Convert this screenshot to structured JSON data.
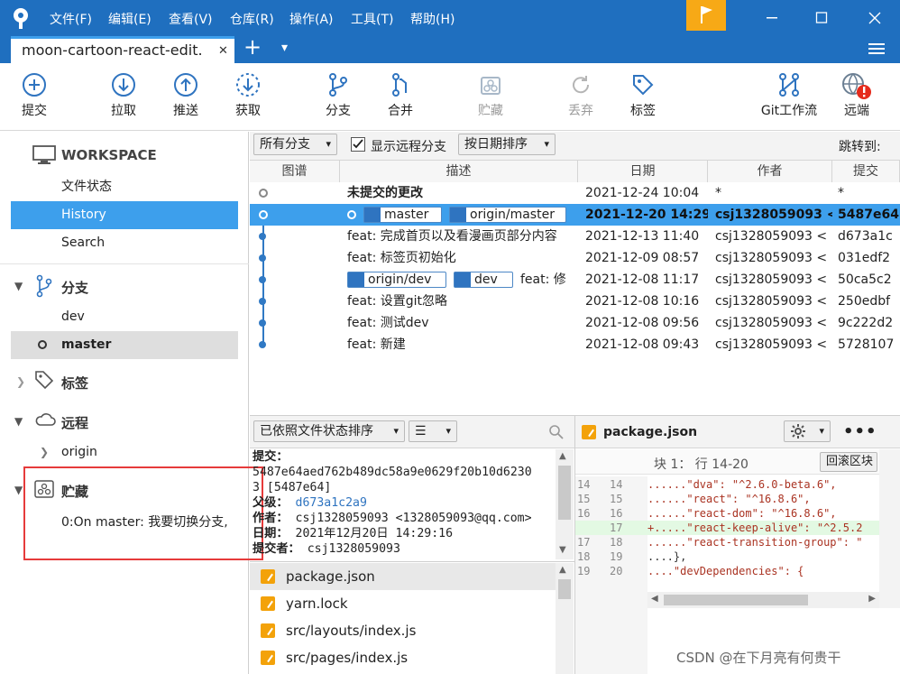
{
  "menu": {
    "items": [
      "文件(F)",
      "编辑(E)",
      "查看(V)",
      "仓库(R)",
      "操作(A)",
      "工具(T)",
      "帮助(H)"
    ]
  },
  "tab": {
    "title": "moon-cartoon-react-edit.",
    "close": "✕",
    "add": "+",
    "dropdown": "▾"
  },
  "toolbar": {
    "commit": "提交",
    "pull": "拉取",
    "push": "推送",
    "fetch": "获取",
    "branch": "分支",
    "merge": "合并",
    "stash": "贮藏",
    "discard": "丢弃",
    "tag": "标签",
    "gitflow": "Git工作流",
    "remote": "远端"
  },
  "sidebar": {
    "workspace": "WORKSPACE",
    "file_status": "文件状态",
    "history": "History",
    "search": "Search",
    "branches_head": "分支",
    "branch_dev": "dev",
    "branch_master": "master",
    "tags_head": "标签",
    "remotes_head": "远程",
    "remote_origin": "origin",
    "stash_head": "贮藏",
    "stash_item": "0:On master: 我要切换分支,"
  },
  "filter": {
    "branches": "所有分支",
    "show_remote": "显示远程分支",
    "sort": "按日期排序",
    "jump": "跳转到:"
  },
  "columns": {
    "graph": "图谱",
    "desc": "描述",
    "date": "日期",
    "author": "作者",
    "commit": "提交"
  },
  "commits": [
    {
      "desc": "未提交的更改",
      "date": "2021-12-24 10:04",
      "author": "*",
      "hash": "*",
      "refs": []
    },
    {
      "desc": "",
      "date": "2021-12-20 14:29",
      "author": "csj1328059093 <",
      "hash": "5487e64",
      "refs": [
        "master",
        "origin/master"
      ]
    },
    {
      "desc": "feat: 完成首页以及看漫画页部分内容",
      "date": "2021-12-13 11:40",
      "author": "csj1328059093 <",
      "hash": "d673a1c",
      "refs": []
    },
    {
      "desc": "feat: 标签页初始化",
      "date": "2021-12-09 08:57",
      "author": "csj1328059093 <",
      "hash": "031edf2",
      "refs": []
    },
    {
      "desc": "feat: 修",
      "date": "2021-12-08 11:17",
      "author": "csj1328059093 <",
      "hash": "50ca5c2",
      "refs": [
        "origin/dev",
        "dev"
      ]
    },
    {
      "desc": "feat: 设置git忽略",
      "date": "2021-12-08 10:16",
      "author": "csj1328059093 <",
      "hash": "250edbf",
      "refs": []
    },
    {
      "desc": "feat: 测试dev",
      "date": "2021-12-08 09:56",
      "author": "csj1328059093 <",
      "hash": "9c222d2",
      "refs": []
    },
    {
      "desc": "feat: 新建",
      "date": "2021-12-08 09:43",
      "author": "csj1328059093 <",
      "hash": "5728107",
      "refs": []
    }
  ],
  "files_panel": {
    "sort": "已依照文件状态排序",
    "view": "☰"
  },
  "details": {
    "commit_label": "提交：",
    "commit_hash_1": "5487e64aed762b489dc58a9e0629f20b10d6230",
    "commit_hash_2": "3 [5487e64]",
    "parent_label": "父级：",
    "parent": "d673a1c2a9",
    "author_label": "作者：",
    "author": "csj1328059093 <1328059093@qq.com>",
    "date_label": "日期：",
    "date": "2021年12月20日 14:29:16",
    "committer_label": "提交者：",
    "committer": "csj1328059093"
  },
  "files": [
    "package.json",
    "yarn.lock",
    "src/layouts/index.js",
    "src/pages/index.js"
  ],
  "diff": {
    "file": "package.json",
    "hunk": "块 1： 行 14-20",
    "revert": "回滚区块",
    "lines": [
      {
        "a": "14",
        "b": "14",
        "text": "......\"dva\": \"^2.6.0-beta.6\",",
        "add": false
      },
      {
        "a": "15",
        "b": "15",
        "text": "......\"react\": \"^16.8.6\",",
        "add": false
      },
      {
        "a": "16",
        "b": "16",
        "text": "......\"react-dom\": \"^16.8.6\",",
        "add": false
      },
      {
        "a": "",
        "b": "17",
        "text": "+.....\"react-keep-alive\": \"^2.5.2",
        "add": true
      },
      {
        "a": "17",
        "b": "18",
        "text": "......\"react-transition-group\": \"",
        "add": false
      },
      {
        "a": "18",
        "b": "19",
        "text": "....},",
        "add": false
      },
      {
        "a": "19",
        "b": "20",
        "text": "....\"devDependencies\": {",
        "add": false
      }
    ]
  },
  "watermark": "CSDN @在下月亮有何贵干",
  "colors": {
    "brand": "#1f6fbf",
    "selection": "#3d9fec",
    "flag": "#f7a916",
    "highlight": "#e63b3b"
  }
}
